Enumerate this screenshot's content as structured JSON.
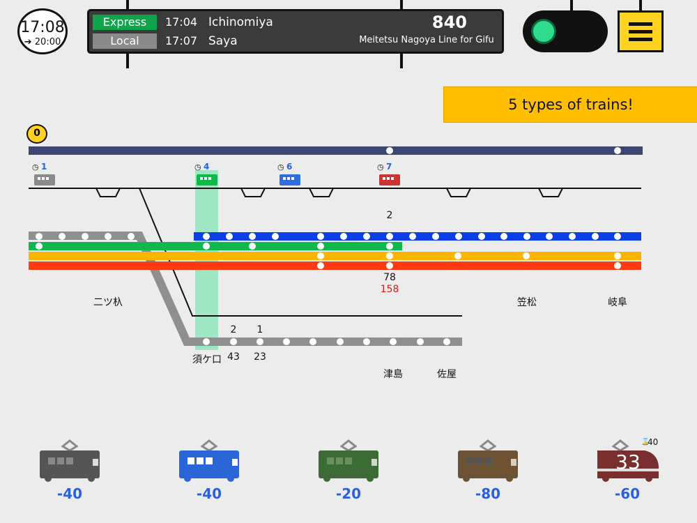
{
  "clock": {
    "time": "17:08",
    "next": "➔ 20:00"
  },
  "board": {
    "departures": [
      {
        "type": "Express",
        "time": "17:04",
        "dest": "Ichinomiya",
        "color": "#0fa54a"
      },
      {
        "type": "Local",
        "time": "17:07",
        "dest": "Saya",
        "color": "#8a8a8a"
      }
    ],
    "score": "840",
    "line_name": "Meitetsu Nagoya Line for Gifu"
  },
  "signal": {
    "state": "green",
    "color": "#2fdc8c"
  },
  "menu": {
    "icon": "hamburger-icon"
  },
  "banner": {
    "text": "5 types of trains!"
  },
  "coins": "0",
  "map": {
    "trains_waiting": [
      {
        "count": "1",
        "color": "#8a8a8a"
      },
      {
        "count": "4",
        "color": "#0fb84a"
      },
      {
        "count": "6",
        "color": "#2e6fe0"
      },
      {
        "count": "7",
        "color": "#cc3333"
      }
    ],
    "numbers": {
      "upper_2": "2",
      "tsushima_78": "78",
      "tsushima_158": "158",
      "branch_2": "2",
      "branch_1": "1",
      "branch_43": "43",
      "branch_23": "23"
    },
    "stations": {
      "futatsusugi": "二ツ杁",
      "kasamatsu": "笠松",
      "gifu": "岐阜",
      "sukeguchi": "須ケ口",
      "tsushima": "津島",
      "saya": "佐屋"
    },
    "line_colors": {
      "top": "#3a4570",
      "blue": "#0a3fe6",
      "green": "#0fb84a",
      "yellow": "#ffb400",
      "red": "#ff3a10",
      "gray": "#8f8f8f",
      "highlight": "#9fe6c4"
    }
  },
  "shop": [
    {
      "price": "-40",
      "color": "#555555"
    },
    {
      "price": "-40",
      "color": "#2a66d8"
    },
    {
      "price": "-20",
      "color": "#3d6b35"
    },
    {
      "price": "-80",
      "color": "#6e5234"
    },
    {
      "price": "-60",
      "color": "#7a2e2e",
      "timer": "33",
      "wait": "40"
    }
  ]
}
